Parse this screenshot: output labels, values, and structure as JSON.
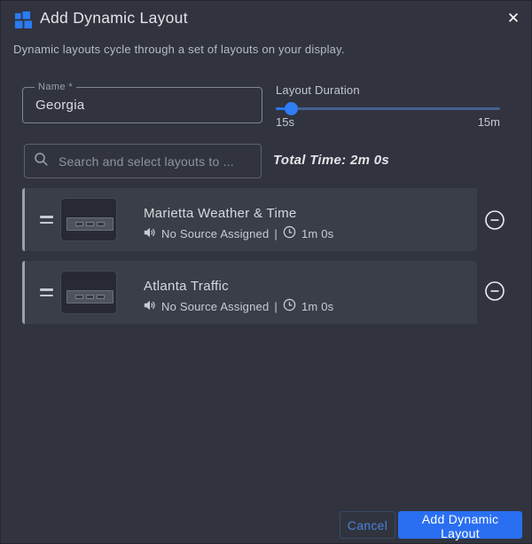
{
  "header": {
    "title": "Add Dynamic Layout",
    "subtitle": "Dynamic layouts cycle through a set of layouts on your display.",
    "close_glyph": "✕"
  },
  "form": {
    "name": {
      "label": "Name *",
      "value": "Georgia"
    },
    "duration": {
      "label": "Layout Duration",
      "min_label": "15s",
      "max_label": "15m",
      "thumb_position_percent": 7
    },
    "search": {
      "placeholder": "Search and select layouts to ...",
      "icon": "search-icon"
    },
    "total_time": "Total Time: 2m 0s"
  },
  "layouts": [
    {
      "title": "Marietta Weather & Time",
      "source": "No Source Assigned",
      "separator": "|",
      "duration": "1m 0s"
    },
    {
      "title": "Atlanta Traffic",
      "source": "No Source Assigned",
      "separator": "|",
      "duration": "1m 0s"
    }
  ],
  "footer": {
    "cancel_label": "Cancel",
    "submit_label": "Add Dynamic Layout"
  },
  "colors": {
    "accent_blue": "#2a6ff2",
    "icon_blue": "#2b7bf3",
    "modal_background": "#31343e",
    "row_background": "#3a3e48",
    "slider_inactive": "#45608f",
    "cancel_text": "#4c82da"
  }
}
